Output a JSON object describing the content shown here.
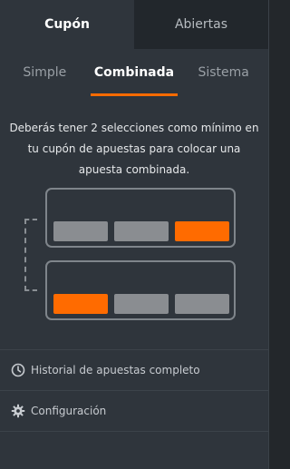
{
  "tabs": {
    "cupon": "Cupón",
    "abiertas": "Abiertas"
  },
  "bet_types": [
    "Simple",
    "Combinada",
    "Sistema"
  ],
  "message": "Deberás tener 2 selecciones como mínimo en tu cupón de apuestas para colocar una apuesta combinada.",
  "links": {
    "history": "Historial de apuestas completo",
    "settings": "Configuración"
  },
  "icons": {
    "history": "history-icon",
    "settings": "gear-icon"
  },
  "colors": {
    "accent": "#ff6b00",
    "panel": "#2f353c",
    "inactive_tab": "#22272c"
  }
}
